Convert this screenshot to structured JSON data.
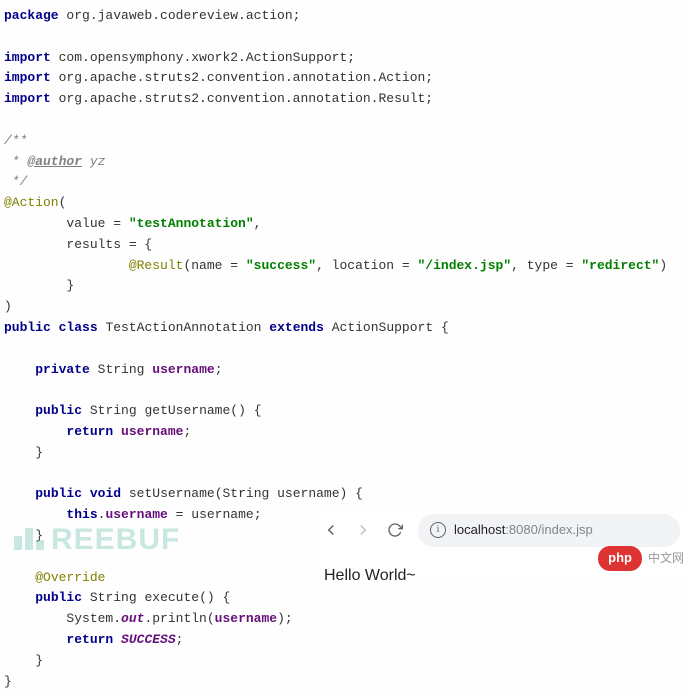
{
  "code": {
    "package_kw": "package",
    "package_name": "org.javaweb.codereview.action",
    "import_kw": "import",
    "import1_pkg": "com.opensymphony.xwork2.",
    "import1_cls": "ActionSupport",
    "import2_pkg": "org.apache.struts2.convention.annotation.",
    "import2_cls": "Action",
    "import3_pkg": "org.apache.struts2.convention.annotation.",
    "import3_cls": "Result",
    "doc_open": "/**",
    "doc_author_tag": "@author",
    "doc_author_name": "yz",
    "doc_close": " */",
    "ann_action": "@Action",
    "value_key": "value = ",
    "value_str": "\"testAnnotation\"",
    "results_key": "results = {",
    "ann_result": "@Result",
    "result_name_key": "name = ",
    "result_name_val": "\"success\"",
    "result_loc_key": ", location = ",
    "result_loc_val": "\"/index.jsp\"",
    "result_type_key": ", type = ",
    "result_type_val": "\"redirect\"",
    "public_kw": "public",
    "class_kw": "class",
    "class_name": "TestActionAnnotation",
    "extends_kw": "extends",
    "super_name": "ActionSupport",
    "private_kw": "private",
    "string_type": "String",
    "field_username": "username",
    "void_kw": "void",
    "method_get": "getUsername",
    "method_set": "setUsername",
    "return_kw": "return",
    "this_kw": "this",
    "override": "@Override",
    "method_exec": "execute",
    "sysout_System": "System.",
    "sysout_out": "out",
    "sysout_println": ".println",
    "success_const": "SUCCESS"
  },
  "browser": {
    "url_host": "localhost",
    "url_port": ":8080",
    "url_path": "/index.jsp",
    "page_text": "Hello World~"
  },
  "watermarks": {
    "freebuf": "REEBUF",
    "php_badge": "php",
    "php_text": "中文网"
  }
}
